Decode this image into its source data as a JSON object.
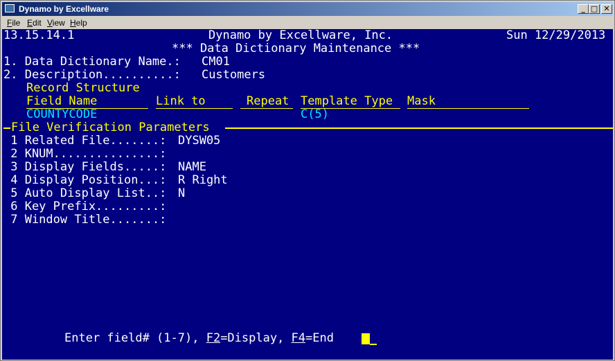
{
  "window": {
    "title": "Dynamo by Excellware",
    "minimize_label": "_",
    "maximize_label": "□",
    "close_label": "✕"
  },
  "menu": {
    "file": {
      "mnemonic": "F",
      "rest": "ile"
    },
    "edit": {
      "mnemonic": "E",
      "rest": "dit"
    },
    "view": {
      "mnemonic": "V",
      "rest": "iew"
    },
    "help": {
      "mnemonic": "H",
      "rest": "elp"
    }
  },
  "header": {
    "version": "13.15.14.1",
    "company": "Dynamo by Excellware, Inc.",
    "date": "Sun 12/29/2013",
    "screen_title": "*** Data Dictionary Maintenance ***"
  },
  "fields": {
    "dd_name_label": "1. Data Dictionary Name.:",
    "dd_name_value": "CM01",
    "description_label": "2. Description..........:",
    "description_value": "Customers"
  },
  "record_structure": {
    "heading": "Record Structure",
    "columns": {
      "field_name": "Field Name",
      "link_to": "Link to",
      "repeat": "Repeat",
      "template_type": "Template Type",
      "mask": "Mask"
    },
    "row": {
      "field_name": "COUNTYCODE",
      "template_type": "C(5)"
    }
  },
  "file_verification": {
    "heading": "File Verification Parameters",
    "items": [
      {
        "label": " 1 Related File.......:",
        "value": "DYSW05"
      },
      {
        "label": " 2 KNUM...............:",
        "value": ""
      },
      {
        "label": " 3 Display Fields.....:",
        "value": "NAME"
      },
      {
        "label": " 4 Display Position...:",
        "value": "R Right"
      },
      {
        "label": " 5 Auto Display List..:",
        "value": "N"
      },
      {
        "label": " 6 Key Prefix.........:",
        "value": ""
      },
      {
        "label": " 7 Window Title.......:",
        "value": ""
      }
    ]
  },
  "prompt": {
    "prefix": "Enter field# (1-7), ",
    "f2_key": "F2",
    "f2_action": "=Display, ",
    "f4_key": "F4",
    "f4_action": "=End "
  },
  "colors": {
    "background": "#000080",
    "text": "#ffffff",
    "highlight": "#ffff00",
    "data": "#00e5ff"
  }
}
